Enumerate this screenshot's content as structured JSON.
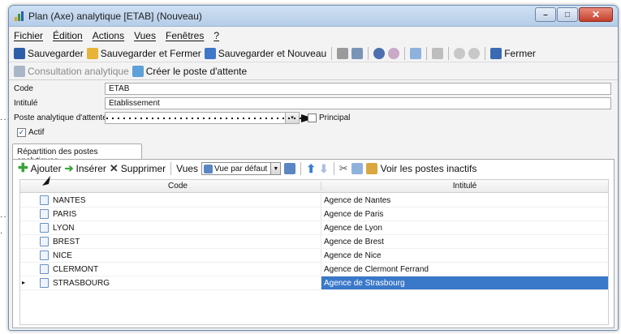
{
  "window": {
    "title": "Plan (Axe) analytique [ETAB] (Nouveau)",
    "controls": {
      "minimize": "–",
      "maximize": "□",
      "close": "✕"
    }
  },
  "menu": [
    "Fichier",
    "Édition",
    "Actions",
    "Vues",
    "Fenêtres",
    "?"
  ],
  "toolbar": {
    "save": "Sauvegarder",
    "save_close": "Sauvegarder et Fermer",
    "save_new": "Sauvegarder et Nouveau",
    "close": "Fermer"
  },
  "toolbar2": {
    "consult": "Consultation analytique",
    "create_waiting": "Créer le poste d'attente"
  },
  "form": {
    "code_label": "Code",
    "code_value": "ETAB",
    "intitule_label": "Intitulé",
    "intitule_value": "Etablissement",
    "poste_label": "Poste analytique d'attente",
    "principal_label": "Principal",
    "actif_label": "Actif",
    "actif_checked": "✓"
  },
  "tab": {
    "label": "Répartition des postes analytiques"
  },
  "grid_toolbar": {
    "add": "Ajouter",
    "insert": "Insérer",
    "delete": "Supprimer",
    "views_label": "Vues",
    "view_value": "Vue par défaut",
    "inactive": "Voir les postes inactifs"
  },
  "grid": {
    "columns": [
      "Code",
      "Intitulé"
    ],
    "rows": [
      {
        "code": "NANTES",
        "intitule": "Agence de Nantes"
      },
      {
        "code": "PARIS",
        "intitule": "Agence de Paris"
      },
      {
        "code": "LYON",
        "intitule": "Agence de Lyon"
      },
      {
        "code": "BREST",
        "intitule": "Agence de Brest"
      },
      {
        "code": "NICE",
        "intitule": "Agence de Nice"
      },
      {
        "code": "CLERMONT",
        "intitule": "Agence de Clermont Ferrand"
      },
      {
        "code": "STRASBOURG",
        "intitule": "Agence de Strasbourg",
        "selected": true,
        "marker": "▸"
      }
    ]
  },
  "colors": {
    "titlebar": "#c3d6ee",
    "selection": "#3a78c9",
    "close_button": "#c2402c",
    "save_icon": "#2f5ea8",
    "add_icon": "#3aa43a",
    "delete_icon": "#333333"
  },
  "icons": [
    "app-icon",
    "save-icon",
    "save-close-icon",
    "save-new-icon",
    "print-icon",
    "preview-icon",
    "undo-icon",
    "redo-icon",
    "copy-icon",
    "delete-icon",
    "close-doc-icon",
    "exit-icon",
    "consult-icon",
    "create-icon",
    "add-icon",
    "insert-icon",
    "delete-x-icon",
    "views-icon",
    "up-arrow-icon",
    "down-arrow-icon",
    "cut-icon",
    "paste-icon",
    "filter-icon",
    "row-icon"
  ]
}
